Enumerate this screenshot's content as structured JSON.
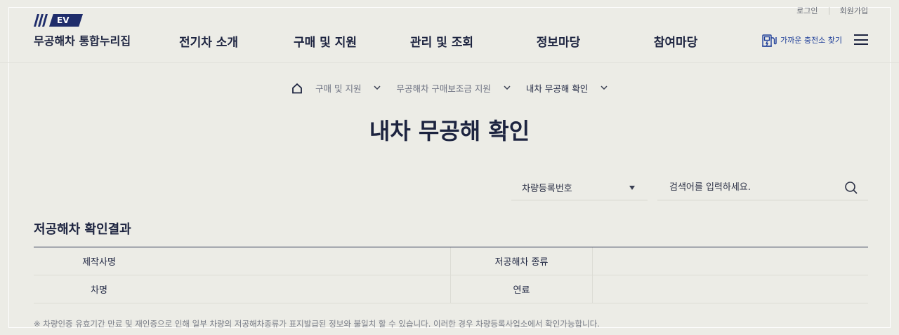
{
  "util_links": {
    "login": "로그인",
    "signup": "회원가입"
  },
  "logo": {
    "badge": "EV",
    "site_name": "무공해차 통합누리집"
  },
  "gnb": {
    "items": [
      "전기차 소개",
      "구매 및 지원",
      "관리 및 조회",
      "정보마당",
      "참여마당"
    ]
  },
  "find_station": {
    "label": "가까운 충전소 찾기",
    "icon": "ev-charger-icon"
  },
  "menu_icon": "hamburger-menu-icon",
  "breadcrumb": {
    "home_icon": "home-icon",
    "items": [
      "구매 및 지원",
      "무공해차 구매보조금 지원",
      "내차 무공해 확인"
    ]
  },
  "page_title": "내차 무공해 확인",
  "search": {
    "select_value": "차량등록번호",
    "placeholder": "검색어를 입력하세요.",
    "icon": "search-icon"
  },
  "result": {
    "title": "저공해차 확인결과",
    "rows": [
      {
        "label1": "제작사명",
        "value1": "",
        "label2": "저공해차 종류",
        "value2": ""
      },
      {
        "label1": "차명",
        "value1": "",
        "label2": "연료",
        "value2": ""
      }
    ]
  },
  "note": "※ 차량인증 유효기간 만료 및 재인증으로 인해 일부 차량의 저공해차종류가 표지발급된 정보와 불일치 할 수 있습니다. 이러한 경우 차량등록사업소에서 확인가능합니다.",
  "colors": {
    "background": "#ecece6",
    "primary": "#1d2440",
    "accent": "#1f3f99",
    "logo_bg": "#1f2d6b"
  }
}
